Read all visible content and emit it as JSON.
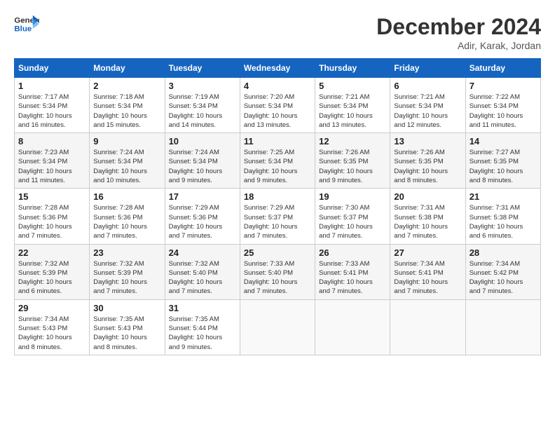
{
  "header": {
    "logo_line1": "General",
    "logo_line2": "Blue",
    "month_title": "December 2024",
    "location": "Adir, Karak, Jordan"
  },
  "weekdays": [
    "Sunday",
    "Monday",
    "Tuesday",
    "Wednesday",
    "Thursday",
    "Friday",
    "Saturday"
  ],
  "weeks": [
    [
      {
        "day": "1",
        "sunrise": "7:17 AM",
        "sunset": "5:34 PM",
        "daylight": "10 hours and 16 minutes."
      },
      {
        "day": "2",
        "sunrise": "7:18 AM",
        "sunset": "5:34 PM",
        "daylight": "10 hours and 15 minutes."
      },
      {
        "day": "3",
        "sunrise": "7:19 AM",
        "sunset": "5:34 PM",
        "daylight": "10 hours and 14 minutes."
      },
      {
        "day": "4",
        "sunrise": "7:20 AM",
        "sunset": "5:34 PM",
        "daylight": "10 hours and 13 minutes."
      },
      {
        "day": "5",
        "sunrise": "7:21 AM",
        "sunset": "5:34 PM",
        "daylight": "10 hours and 13 minutes."
      },
      {
        "day": "6",
        "sunrise": "7:21 AM",
        "sunset": "5:34 PM",
        "daylight": "10 hours and 12 minutes."
      },
      {
        "day": "7",
        "sunrise": "7:22 AM",
        "sunset": "5:34 PM",
        "daylight": "10 hours and 11 minutes."
      }
    ],
    [
      {
        "day": "8",
        "sunrise": "7:23 AM",
        "sunset": "5:34 PM",
        "daylight": "10 hours and 11 minutes."
      },
      {
        "day": "9",
        "sunrise": "7:24 AM",
        "sunset": "5:34 PM",
        "daylight": "10 hours and 10 minutes."
      },
      {
        "day": "10",
        "sunrise": "7:24 AM",
        "sunset": "5:34 PM",
        "daylight": "10 hours and 9 minutes."
      },
      {
        "day": "11",
        "sunrise": "7:25 AM",
        "sunset": "5:34 PM",
        "daylight": "10 hours and 9 minutes."
      },
      {
        "day": "12",
        "sunrise": "7:26 AM",
        "sunset": "5:35 PM",
        "daylight": "10 hours and 9 minutes."
      },
      {
        "day": "13",
        "sunrise": "7:26 AM",
        "sunset": "5:35 PM",
        "daylight": "10 hours and 8 minutes."
      },
      {
        "day": "14",
        "sunrise": "7:27 AM",
        "sunset": "5:35 PM",
        "daylight": "10 hours and 8 minutes."
      }
    ],
    [
      {
        "day": "15",
        "sunrise": "7:28 AM",
        "sunset": "5:36 PM",
        "daylight": "10 hours and 7 minutes."
      },
      {
        "day": "16",
        "sunrise": "7:28 AM",
        "sunset": "5:36 PM",
        "daylight": "10 hours and 7 minutes."
      },
      {
        "day": "17",
        "sunrise": "7:29 AM",
        "sunset": "5:36 PM",
        "daylight": "10 hours and 7 minutes."
      },
      {
        "day": "18",
        "sunrise": "7:29 AM",
        "sunset": "5:37 PM",
        "daylight": "10 hours and 7 minutes."
      },
      {
        "day": "19",
        "sunrise": "7:30 AM",
        "sunset": "5:37 PM",
        "daylight": "10 hours and 7 minutes."
      },
      {
        "day": "20",
        "sunrise": "7:31 AM",
        "sunset": "5:38 PM",
        "daylight": "10 hours and 7 minutes."
      },
      {
        "day": "21",
        "sunrise": "7:31 AM",
        "sunset": "5:38 PM",
        "daylight": "10 hours and 6 minutes."
      }
    ],
    [
      {
        "day": "22",
        "sunrise": "7:32 AM",
        "sunset": "5:39 PM",
        "daylight": "10 hours and 6 minutes."
      },
      {
        "day": "23",
        "sunrise": "7:32 AM",
        "sunset": "5:39 PM",
        "daylight": "10 hours and 7 minutes."
      },
      {
        "day": "24",
        "sunrise": "7:32 AM",
        "sunset": "5:40 PM",
        "daylight": "10 hours and 7 minutes."
      },
      {
        "day": "25",
        "sunrise": "7:33 AM",
        "sunset": "5:40 PM",
        "daylight": "10 hours and 7 minutes."
      },
      {
        "day": "26",
        "sunrise": "7:33 AM",
        "sunset": "5:41 PM",
        "daylight": "10 hours and 7 minutes."
      },
      {
        "day": "27",
        "sunrise": "7:34 AM",
        "sunset": "5:41 PM",
        "daylight": "10 hours and 7 minutes."
      },
      {
        "day": "28",
        "sunrise": "7:34 AM",
        "sunset": "5:42 PM",
        "daylight": "10 hours and 7 minutes."
      }
    ],
    [
      {
        "day": "29",
        "sunrise": "7:34 AM",
        "sunset": "5:43 PM",
        "daylight": "10 hours and 8 minutes."
      },
      {
        "day": "30",
        "sunrise": "7:35 AM",
        "sunset": "5:43 PM",
        "daylight": "10 hours and 8 minutes."
      },
      {
        "day": "31",
        "sunrise": "7:35 AM",
        "sunset": "5:44 PM",
        "daylight": "10 hours and 9 minutes."
      },
      null,
      null,
      null,
      null
    ]
  ],
  "labels": {
    "sunrise": "Sunrise:",
    "sunset": "Sunset:",
    "daylight": "Daylight:"
  }
}
